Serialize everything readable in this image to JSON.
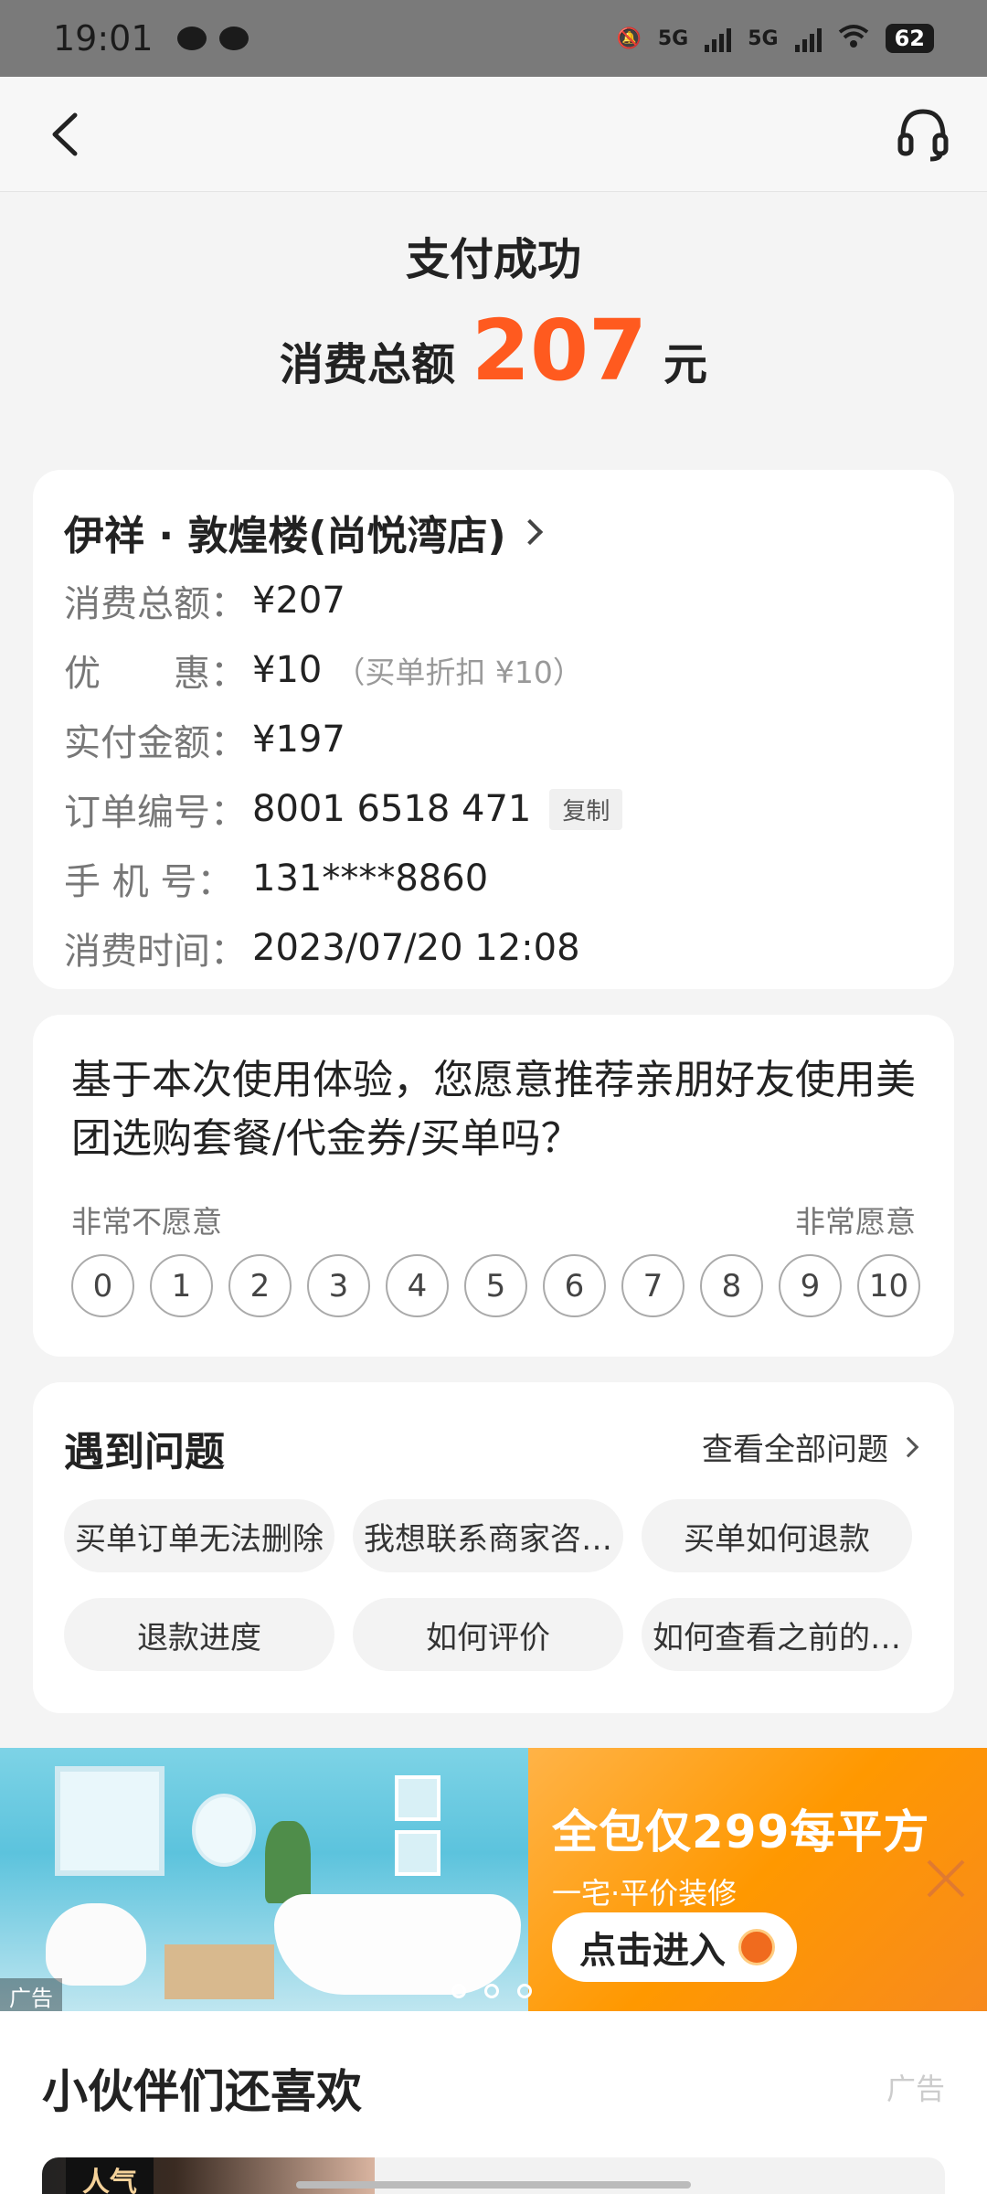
{
  "status_bar": {
    "time": "19:01",
    "battery": "62",
    "network_1": "5G",
    "network_2": "5G"
  },
  "nav": {
    "back_icon": "chevron-left-icon",
    "support_icon": "headset-icon"
  },
  "header": {
    "title": "支付成功",
    "amount_label": "消费总额",
    "amount_value": "207",
    "amount_unit": "元",
    "accent_color": "#ff5a1f"
  },
  "order": {
    "store_name": "伊祥 · 敦煌楼(尚悦湾店)",
    "rows": [
      {
        "label": "消费总额：",
        "value": "¥207",
        "note": ""
      },
      {
        "label": "优　　惠：",
        "value": "¥10",
        "note": "（买单折扣 ¥10）"
      },
      {
        "label": "实付金额：",
        "value": "¥197",
        "note": ""
      },
      {
        "label": "订单编号：",
        "value": "8001 6518 471",
        "note": ""
      },
      {
        "label": "手 机 号：",
        "value": "131****8860",
        "note": ""
      },
      {
        "label": "消费时间：",
        "value": "2023/07/20 12:08",
        "note": ""
      }
    ],
    "copy_label": "复制"
  },
  "survey": {
    "question": "基于本次使用体验，您愿意推荐亲朋好友使用美团选购套餐/代金券/买单吗？",
    "scale_low": "非常不愿意",
    "scale_high": "非常愿意",
    "scores": [
      "0",
      "1",
      "2",
      "3",
      "4",
      "5",
      "6",
      "7",
      "8",
      "9",
      "10"
    ]
  },
  "help": {
    "title": "遇到问题",
    "view_all": "查看全部问题",
    "chips": [
      "买单订单无法删除",
      "我想联系商家咨…",
      "买单如何退款",
      "退款进度",
      "如何评价",
      "如何查看之前的…"
    ]
  },
  "banner": {
    "promo_title": "全包仅299每平方",
    "promo_sub": "一宅·平价装修",
    "promo_button": "点击进入",
    "ad_tag": "广告"
  },
  "recommend": {
    "title": "小伙伴们还喜欢",
    "ad_label": "广告",
    "hot_tag": "人气"
  }
}
